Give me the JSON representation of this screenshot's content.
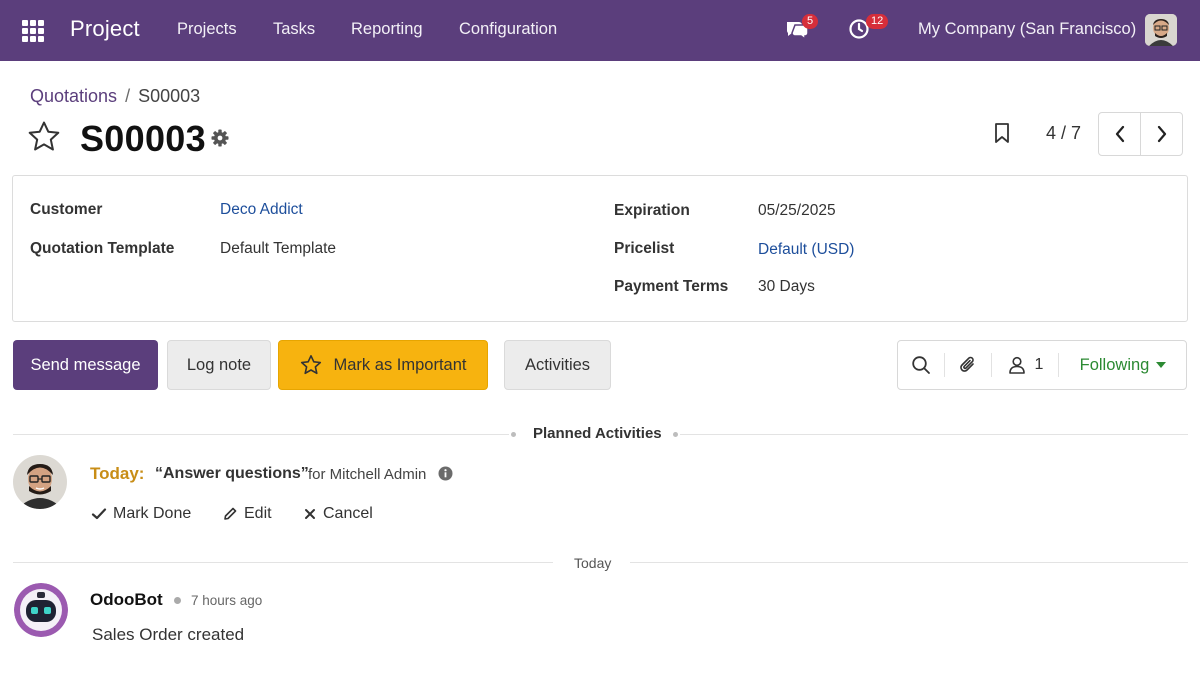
{
  "navbar": {
    "brand": "Project",
    "menu": [
      "Projects",
      "Tasks",
      "Reporting",
      "Configuration"
    ],
    "messages_badge": "5",
    "activities_badge": "12",
    "company": "My Company (San Francisco)",
    "background": "#5b3e7c"
  },
  "breadcrumb": {
    "parent": "Quotations",
    "separator": "/",
    "current": "S00003"
  },
  "record": {
    "title": "S00003"
  },
  "pager": {
    "value": "4 / 7"
  },
  "form": {
    "customer_label": "Customer",
    "customer_value": "Deco Addict",
    "template_label": "Quotation Template",
    "template_value": "Default Template",
    "expiration_label": "Expiration",
    "expiration_value": "05/25/2025",
    "pricelist_label": "Pricelist",
    "pricelist_value": "Default (USD)",
    "payment_terms_label": "Payment Terms",
    "payment_terms_value": "30 Days"
  },
  "chatter": {
    "send_message": "Send message",
    "log_note": "Log note",
    "mark_important": "Mark as Important",
    "activities": "Activities",
    "followers_count": "1",
    "following": "Following"
  },
  "planned": {
    "section_title": "Planned Activities",
    "due": "Today:",
    "summary": "“Answer questions”",
    "assignee": "for Mitchell Admin",
    "mark_done": "Mark Done",
    "edit": "Edit",
    "cancel": "Cancel"
  },
  "messages": {
    "date_separator": "Today",
    "author": "OdooBot",
    "time": "7 hours ago",
    "body": "Sales Order created"
  },
  "colors": {
    "primary": "#5b3e7c",
    "warning": "#f7b30f",
    "link": "#1d4e9b",
    "following": "#2c8a33",
    "today": "#c88d16",
    "badge": "#d62e3a"
  }
}
